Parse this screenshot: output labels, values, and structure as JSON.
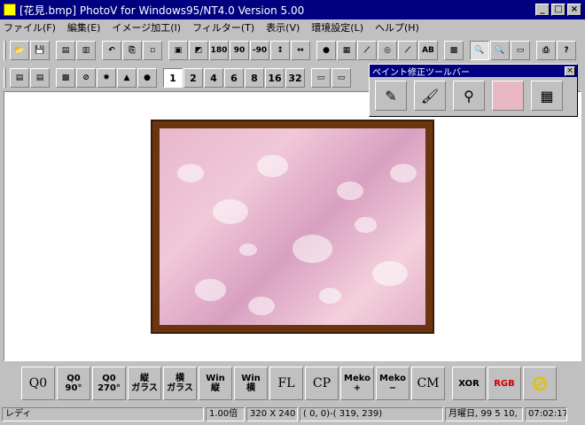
{
  "window": {
    "title": "[花見.bmp] PhotoV for Windows95/NT4.0 Version 5.00",
    "caption_buttons": [
      "_",
      "□",
      "×"
    ]
  },
  "menu": [
    "ファイル(F)",
    "編集(E)",
    "イメージ加工(I)",
    "フィルター(T)",
    "表示(V)",
    "環境設定(L)",
    "ヘルプ(H)"
  ],
  "toolbar1": {
    "buttons": [
      {
        "name": "open-folder-icon",
        "glyph": "📂"
      },
      {
        "name": "save-icon",
        "glyph": "💾"
      },
      {
        "name": "catalog-icon",
        "glyph": "▤"
      },
      {
        "name": "filmstrip-icon",
        "glyph": "▥"
      },
      {
        "name": "undo-icon",
        "glyph": "↶"
      },
      {
        "name": "copy-icon",
        "glyph": "⎘"
      },
      {
        "name": "paste-icon",
        "glyph": "▫"
      },
      {
        "name": "trim-icon",
        "glyph": "▣"
      },
      {
        "name": "resize-icon",
        "glyph": "◩"
      },
      {
        "name": "rotate-180-icon",
        "glyph": "180"
      },
      {
        "name": "rotate-90-icon",
        "glyph": "90"
      },
      {
        "name": "rotate-minus-90-icon",
        "glyph": "-90"
      },
      {
        "name": "flip-vertical-icon",
        "glyph": "↕"
      },
      {
        "name": "flip-horizontal-icon",
        "glyph": "↔"
      },
      {
        "name": "rgb-icon",
        "glyph": "●"
      },
      {
        "name": "histogram-icon",
        "glyph": "▦"
      },
      {
        "name": "gamma-icon",
        "glyph": "⟋"
      },
      {
        "name": "color-wheel-icon",
        "glyph": "◎"
      },
      {
        "name": "edge-icon",
        "glyph": "⟋"
      },
      {
        "name": "text-icon",
        "glyph": "AB"
      },
      {
        "name": "mosaic-icon",
        "glyph": "▩"
      },
      {
        "name": "zoom-in-icon",
        "glyph": "🔍"
      },
      {
        "name": "zoom-out-icon",
        "glyph": "🔍"
      },
      {
        "name": "fullscreen-icon",
        "glyph": "▭"
      },
      {
        "name": "print-icon",
        "glyph": "⎙"
      },
      {
        "name": "help-icon",
        "glyph": "?"
      }
    ]
  },
  "toolbar2": {
    "left_buttons": [
      {
        "name": "scan-icon",
        "glyph": "▤"
      },
      {
        "name": "scan2-icon",
        "glyph": "▤"
      },
      {
        "name": "select-rect-icon",
        "glyph": "▩"
      },
      {
        "name": "pen-icon",
        "glyph": "⊘"
      },
      {
        "name": "gear-icon",
        "glyph": "✹"
      },
      {
        "name": "triangle-icon",
        "glyph": "▲"
      },
      {
        "name": "circle-icon",
        "glyph": "●"
      }
    ],
    "numbers": [
      "1",
      "2",
      "4",
      "6",
      "8",
      "16",
      "32"
    ],
    "right_buttons": [
      {
        "name": "window-icon",
        "glyph": "▭"
      },
      {
        "name": "window2-icon",
        "glyph": "▭"
      }
    ]
  },
  "paint_palette": {
    "title": "ペイント修正ツールバー",
    "close": "×",
    "tools": [
      {
        "name": "pencil-icon",
        "glyph": "✎"
      },
      {
        "name": "brush-icon",
        "glyph": "🖌"
      },
      {
        "name": "eyedropper-icon",
        "glyph": "⚲"
      }
    ],
    "current_color": "#e8b8c4"
  },
  "image": {
    "file": "花見.bmp",
    "frame_color": "#6b3510"
  },
  "effect_bar": [
    {
      "name": "q0-button",
      "lines": [
        "Q0"
      ],
      "big": true
    },
    {
      "name": "q0-90-button",
      "lines": [
        "Q0",
        "90°"
      ]
    },
    {
      "name": "q0-270-button",
      "lines": [
        "Q0",
        "270°"
      ]
    },
    {
      "name": "vertical-glass-button",
      "lines": [
        "縦",
        "ガラス"
      ]
    },
    {
      "name": "horizontal-glass-button",
      "lines": [
        "横",
        "ガラス"
      ]
    },
    {
      "name": "win-vertical-button",
      "lines": [
        "Win",
        "縦"
      ]
    },
    {
      "name": "win-horizontal-button",
      "lines": [
        "Win",
        "横"
      ]
    },
    {
      "name": "fl-button",
      "lines": [
        "FL"
      ],
      "big": true
    },
    {
      "name": "cp-button",
      "lines": [
        "CP"
      ],
      "big": true
    },
    {
      "name": "meko-plus-button",
      "lines": [
        "Meko",
        "+"
      ]
    },
    {
      "name": "meko-minus-button",
      "lines": [
        "Meko",
        "−"
      ]
    },
    {
      "name": "cm-button",
      "lines": [
        "CM"
      ],
      "big": true
    },
    {
      "name": "xor-button",
      "lines": [
        "XOR"
      ]
    },
    {
      "name": "rgb-button",
      "lines": [
        "RGB"
      ]
    },
    {
      "name": "cancel-icon",
      "lines": [
        "⊘"
      ]
    }
  ],
  "status": {
    "ready": "レディ",
    "zoom": "1.00倍",
    "size": "320 X 240",
    "coords": "(   0,    0)-( 319, 239)",
    "date": "月曜日, 99 5 10,",
    "time": "07:02:17"
  }
}
